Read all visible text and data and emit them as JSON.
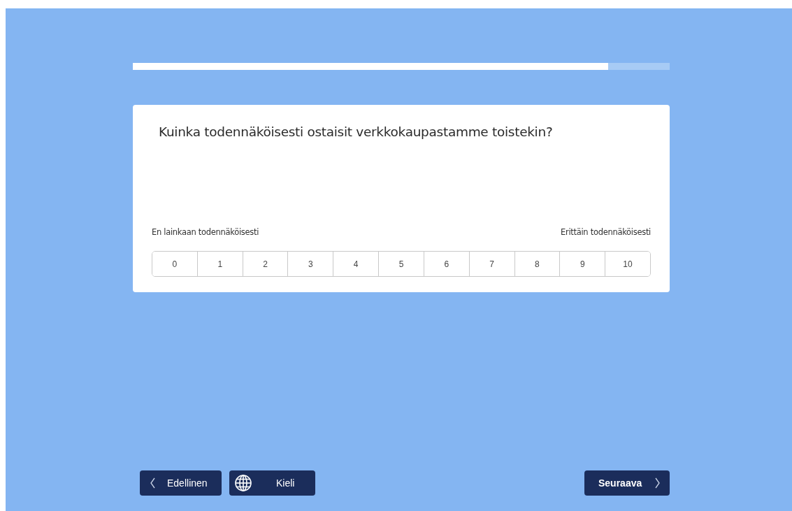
{
  "progress": {
    "level": 0.885
  },
  "question": "Kuinka todennäköisesti ostaisit verkkokaupastamme toistekin?",
  "scale_labels": {
    "low": "En lainkaan todennäköisesti",
    "high": "Erittäin todennäköisesti"
  },
  "options": [
    {
      "label": "0",
      "selected": false
    },
    {
      "label": "1",
      "selected": false
    },
    {
      "label": "2",
      "selected": false
    },
    {
      "label": "3",
      "selected": false
    },
    {
      "label": "4",
      "selected": false
    },
    {
      "label": "5",
      "selected": false
    },
    {
      "label": "6",
      "selected": false
    },
    {
      "label": "7",
      "selected": false
    },
    {
      "label": "8",
      "selected": false
    },
    {
      "label": "9",
      "selected": false
    },
    {
      "label": "10",
      "selected": false
    }
  ],
  "buttons": [
    {
      "kind": "back",
      "label": "Edellinen"
    },
    {
      "kind": "language",
      "label": "Kieli"
    },
    {
      "kind": "next",
      "label": "Seuraava"
    }
  ]
}
